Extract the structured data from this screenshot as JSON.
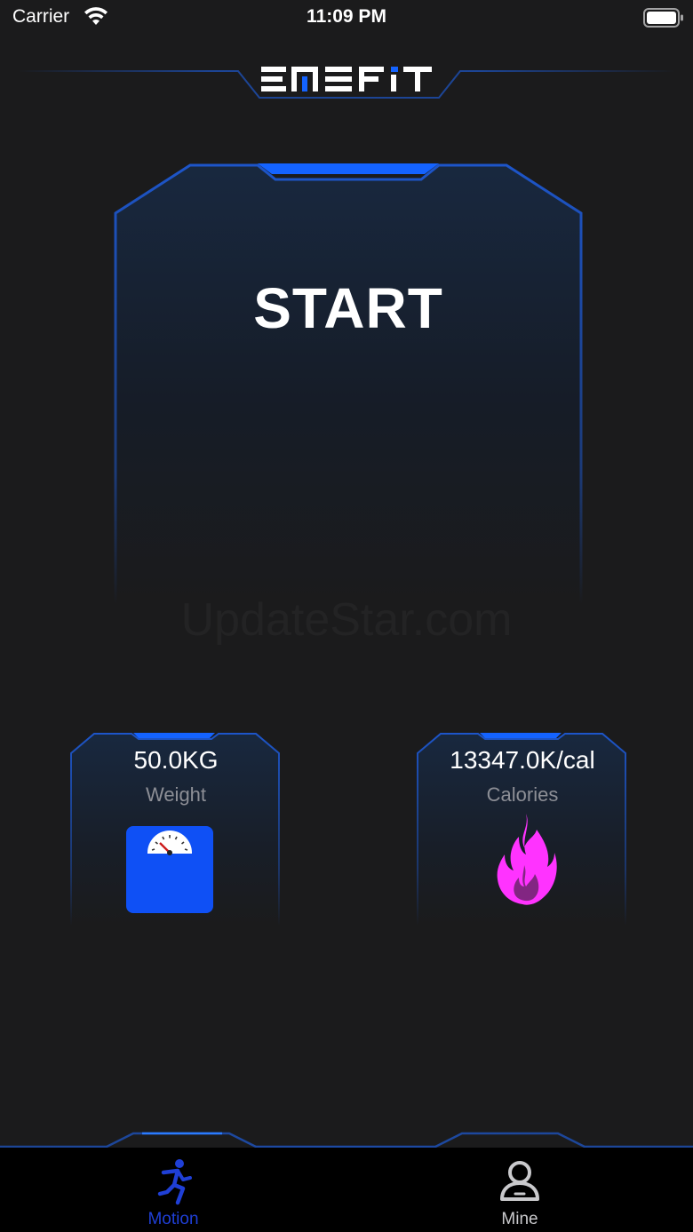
{
  "status_bar": {
    "carrier": "Carrier",
    "time": "11:09 PM"
  },
  "header": {
    "logo_text": "EMSFIT"
  },
  "main": {
    "start_label": "START",
    "watermark": "UpdateStar.com"
  },
  "stats": {
    "weight": {
      "value": "50.0KG",
      "label": "Weight",
      "icon": "scale-icon"
    },
    "calories": {
      "value": "13347.0K/cal",
      "label": "Calories",
      "icon": "flame-icon"
    }
  },
  "tabs": [
    {
      "label": "Motion",
      "icon": "running-man-icon",
      "active": true
    },
    {
      "label": "Mine",
      "icon": "person-icon",
      "active": false
    }
  ],
  "colors": {
    "background": "#1b1b1c",
    "accent_blue": "#1463ff",
    "frame_blue": "#1d4fb3",
    "tab_active": "#1f3fd6",
    "flame": "#ff33ff"
  }
}
